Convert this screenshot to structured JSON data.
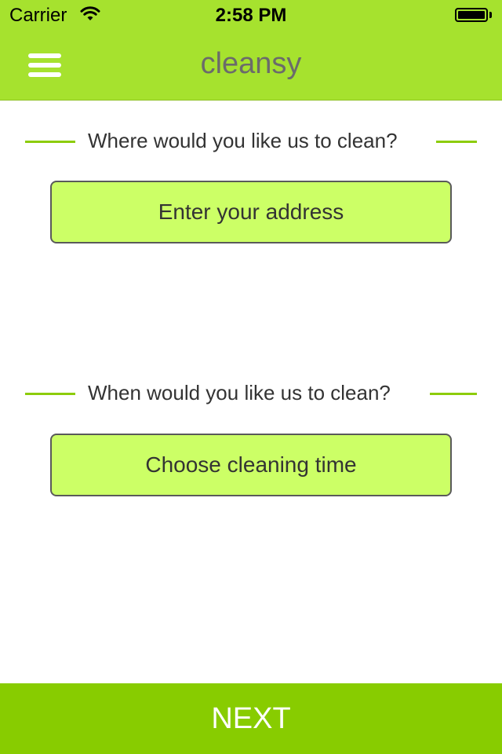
{
  "status_bar": {
    "carrier": "Carrier",
    "time": "2:58 PM",
    "wifi_icon": "wifi-icon",
    "battery_icon": "battery-icon"
  },
  "header": {
    "menu_icon": "hamburger-menu-icon",
    "title": "cleansy",
    "background_color": "#a6e22e"
  },
  "location_section": {
    "label": "Where would you like us to clean?",
    "button_label": "Enter your address"
  },
  "time_section": {
    "label": "When would you like us to clean?",
    "button_label": "Choose cleaning time"
  },
  "footer": {
    "next_label": "NEXT",
    "background_color": "#88cc00"
  },
  "colors": {
    "accent_line": "#8dcc0b",
    "button_fill": "#ccff66"
  }
}
